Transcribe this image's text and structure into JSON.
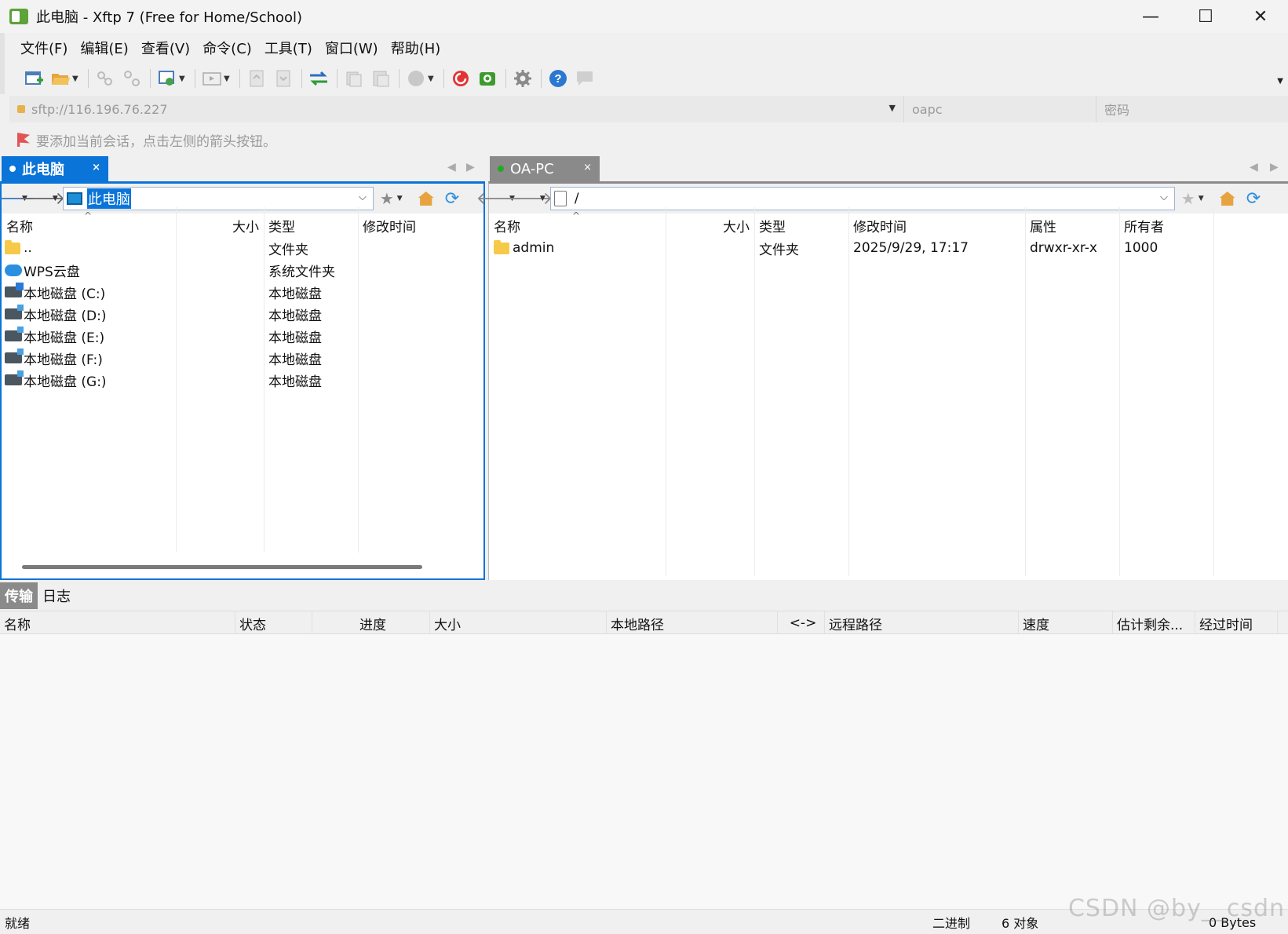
{
  "window": {
    "title": "此电脑 - Xftp 7 (Free for Home/School)",
    "minimize": "—",
    "maximize": "☐",
    "close": "✕"
  },
  "menu": [
    "文件(F)",
    "编辑(E)",
    "查看(V)",
    "命令(C)",
    "工具(T)",
    "窗口(W)",
    "帮助(H)"
  ],
  "address": {
    "host": "sftp://116.196.76.227",
    "username_placeholder": "oapc",
    "password_placeholder": "密码"
  },
  "hint": "要添加当前会话，点击左侧的箭头按钮。",
  "local_tab": {
    "label": "此电脑",
    "dot_color": "#ffffff"
  },
  "remote_tab": {
    "label": "OA-PC",
    "dot_color": "#22aa22"
  },
  "tab_close": "×",
  "local": {
    "path": "此电脑",
    "columns": {
      "name": "名称",
      "size": "大小",
      "type": "类型",
      "modified": "修改时间"
    },
    "rows": [
      {
        "icon": "folder-icon",
        "name": "..",
        "type": "文件夹"
      },
      {
        "icon": "cloud-icon",
        "name": "WPS云盘",
        "type": "系统文件夹"
      },
      {
        "icon": "windows-disk-icon",
        "name": "本地磁盘 (C:)",
        "type": "本地磁盘"
      },
      {
        "icon": "disk-icon",
        "name": "本地磁盘 (D:)",
        "type": "本地磁盘"
      },
      {
        "icon": "disk-icon",
        "name": "本地磁盘 (E:)",
        "type": "本地磁盘"
      },
      {
        "icon": "disk-icon",
        "name": "本地磁盘 (F:)",
        "type": "本地磁盘"
      },
      {
        "icon": "disk-icon",
        "name": "本地磁盘 (G:)",
        "type": "本地磁盘"
      }
    ]
  },
  "remote": {
    "path": "/",
    "columns": {
      "name": "名称",
      "size": "大小",
      "type": "类型",
      "modified": "修改时间",
      "attrs": "属性",
      "owner": "所有者"
    },
    "rows": [
      {
        "icon": "folder-icon",
        "name": "admin",
        "type": "文件夹",
        "modified": "2025/9/29, 17:17",
        "attrs": "drwxr-xr-x",
        "owner": "1000"
      }
    ]
  },
  "transfer": {
    "tabs": [
      "传输",
      "日志"
    ],
    "columns": [
      "名称",
      "状态",
      "进度",
      "大小",
      "本地路径",
      "<->",
      "远程路径",
      "速度",
      "估计剩余...",
      "经过时间"
    ]
  },
  "status": {
    "ready": "就绪",
    "mode": "二进制",
    "objects": "6 对象",
    "bytes": "0 Bytes"
  },
  "watermark": "CSDN @by__csdn",
  "colors": {
    "accent": "#0a74d8",
    "inactive_tab": "#8a8a8a"
  }
}
